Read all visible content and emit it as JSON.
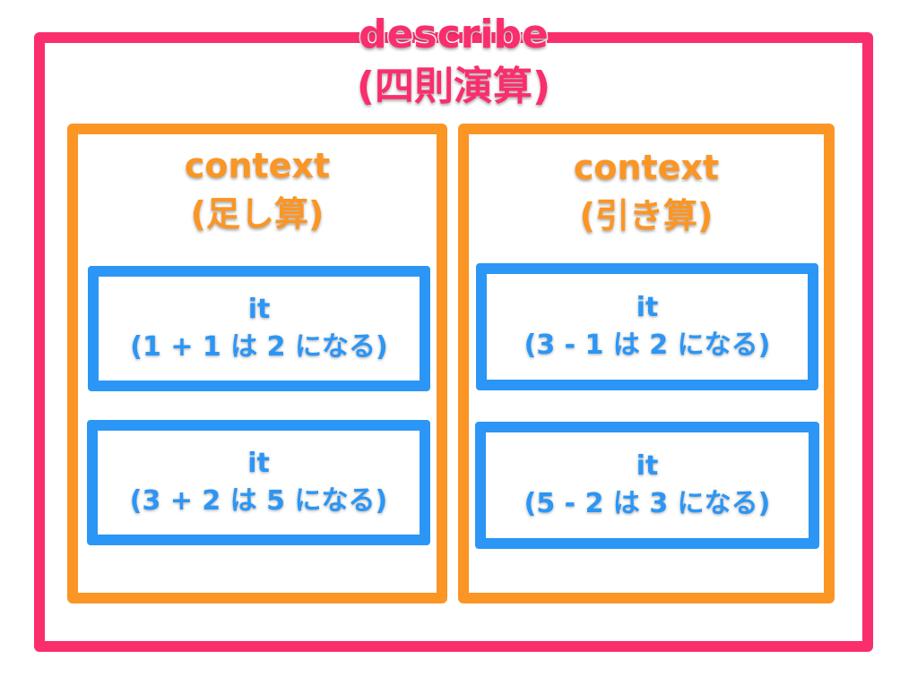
{
  "describe": {
    "keyword": "describe",
    "subtitle": "(四則演算)"
  },
  "contexts": [
    {
      "keyword": "context",
      "subtitle": "(足し算)",
      "its": [
        {
          "keyword": "it",
          "description": "(1 + 1 は 2 になる)"
        },
        {
          "keyword": "it",
          "description": "(3 + 2 は 5 になる)"
        }
      ]
    },
    {
      "keyword": "context",
      "subtitle": "(引き算)",
      "its": [
        {
          "keyword": "it",
          "description": "(3 - 1 は 2 になる)"
        },
        {
          "keyword": "it",
          "description": "(5 - 2 は 3 になる)"
        }
      ]
    }
  ],
  "colors": {
    "describe": "#fa2d6d",
    "context": "#fb9524",
    "it": "#2b96f5"
  }
}
